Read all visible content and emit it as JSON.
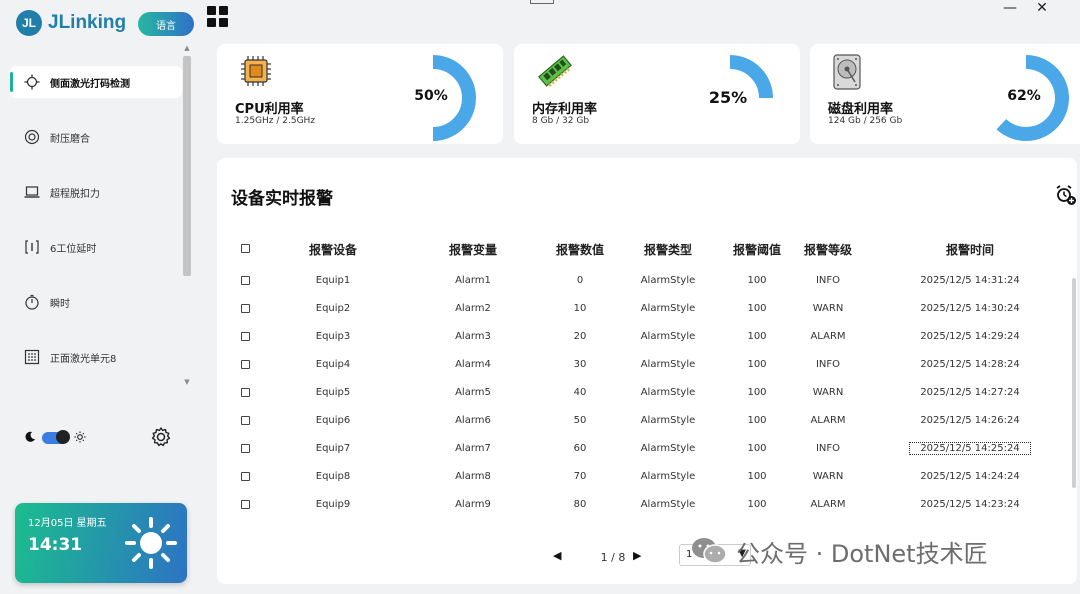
{
  "app": {
    "logo_mark": "JL",
    "name": "JLinking",
    "language_button": "语言"
  },
  "sidebar": {
    "items": [
      {
        "label": "侧面激光打码检测",
        "icon": "crosshair-icon",
        "active": true
      },
      {
        "label": "耐压磨合",
        "icon": "gauge-icon",
        "active": false
      },
      {
        "label": "超程脱扣力",
        "icon": "laptop-icon",
        "active": false
      },
      {
        "label": "6工位延时",
        "icon": "bracket-icon",
        "active": false
      },
      {
        "label": "瞬时",
        "icon": "stopwatch-icon",
        "active": false
      },
      {
        "label": "正面激光单元8",
        "icon": "grid-dots-icon",
        "active": false
      }
    ],
    "theme_toggle": "dark",
    "weather": {
      "date": "12月05日  星期五",
      "time": "14:31",
      "icon": "sun-icon"
    }
  },
  "stats": [
    {
      "title": "CPU利用率",
      "sub": "1.25GHz / 2.5GHz",
      "percent": 50,
      "percent_label": "50%",
      "icon": "cpu-chip-icon"
    },
    {
      "title": "内存利用率",
      "sub": "8 Gb / 32 Gb",
      "percent": 25,
      "percent_label": "25%",
      "icon": "memory-stick-icon"
    },
    {
      "title": "磁盘利用率",
      "sub": "124 Gb / 256 Gb",
      "percent": 62,
      "percent_label": "62%",
      "icon": "hard-disk-icon"
    }
  ],
  "alarms": {
    "title": "设备实时报警",
    "columns": [
      "报警设备",
      "报警变量",
      "报警数值",
      "报警类型",
      "报警阈值",
      "报警等级",
      "报警时间"
    ],
    "rows": [
      [
        "Equip1",
        "Alarm1",
        "0",
        "AlarmStyle",
        "100",
        "INFO",
        "2025/12/5 14:31:24"
      ],
      [
        "Equip2",
        "Alarm2",
        "10",
        "AlarmStyle",
        "100",
        "WARN",
        "2025/12/5 14:30:24"
      ],
      [
        "Equip3",
        "Alarm3",
        "20",
        "AlarmStyle",
        "100",
        "ALARM",
        "2025/12/5 14:29:24"
      ],
      [
        "Equip4",
        "Alarm4",
        "30",
        "AlarmStyle",
        "100",
        "INFO",
        "2025/12/5 14:28:24"
      ],
      [
        "Equip5",
        "Alarm5",
        "40",
        "AlarmStyle",
        "100",
        "WARN",
        "2025/12/5 14:27:24"
      ],
      [
        "Equip6",
        "Alarm6",
        "50",
        "AlarmStyle",
        "100",
        "ALARM",
        "2025/12/5 14:26:24"
      ],
      [
        "Equip7",
        "Alarm7",
        "60",
        "AlarmStyle",
        "100",
        "INFO",
        "2025/12/5 14:25:24"
      ],
      [
        "Equip8",
        "Alarm8",
        "70",
        "AlarmStyle",
        "100",
        "WARN",
        "2025/12/5 14:24:24"
      ],
      [
        "Equip9",
        "Alarm9",
        "80",
        "AlarmStyle",
        "100",
        "ALARM",
        "2025/12/5 14:23:24"
      ]
    ],
    "pager": {
      "info": "1 / 8",
      "page_size": "1"
    }
  },
  "watermark": "公众号 · DotNet技术匠",
  "colors": {
    "accent": "#1f7fa8",
    "gauge": "#4aa8e8",
    "active_bar": "#1db39a"
  }
}
